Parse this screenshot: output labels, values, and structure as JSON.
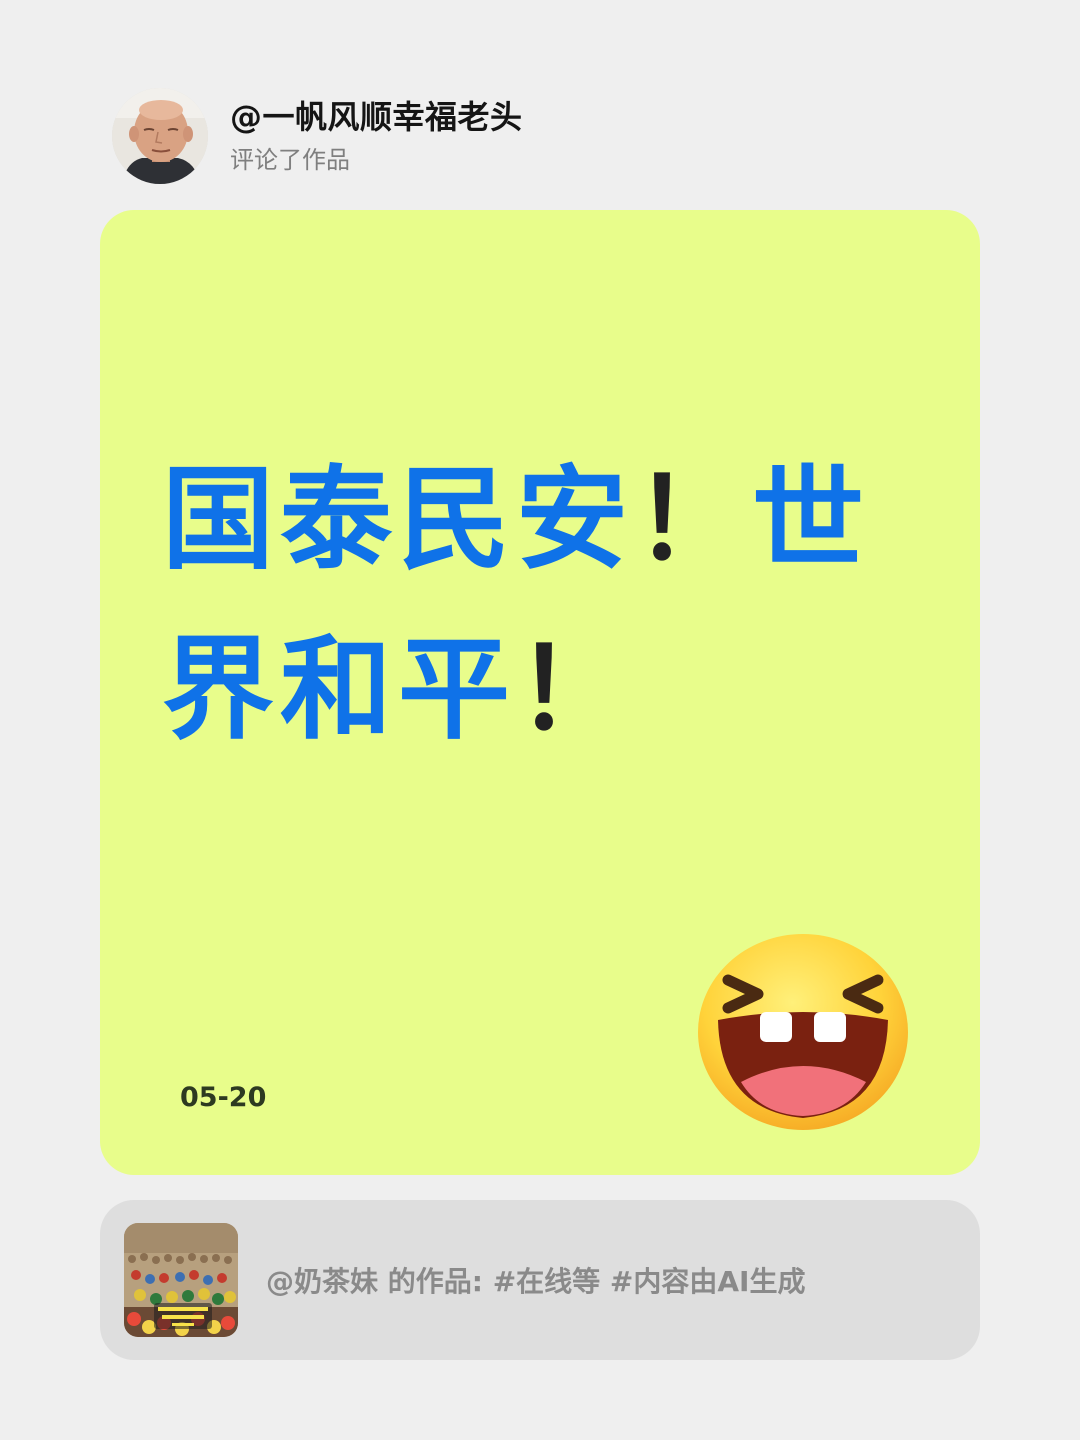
{
  "header": {
    "username": "@一帆风顺幸福老头",
    "action": "评论了作品",
    "avatar_icon": "user-avatar"
  },
  "comment": {
    "text_main": "国泰民安",
    "excl1": "！",
    "text_second": "世界和平",
    "excl2": "！",
    "date": "05-20",
    "emoji_icon": "laughing-squint-emoji",
    "card_color": "#e8fd8b",
    "text_color": "#0f72e8"
  },
  "work": {
    "label": "@奶茶妹 的作品: #在线等 #内容由AI生成",
    "thumbnail_icon": "crowd-thumbnail",
    "card_color": "#dedede"
  }
}
